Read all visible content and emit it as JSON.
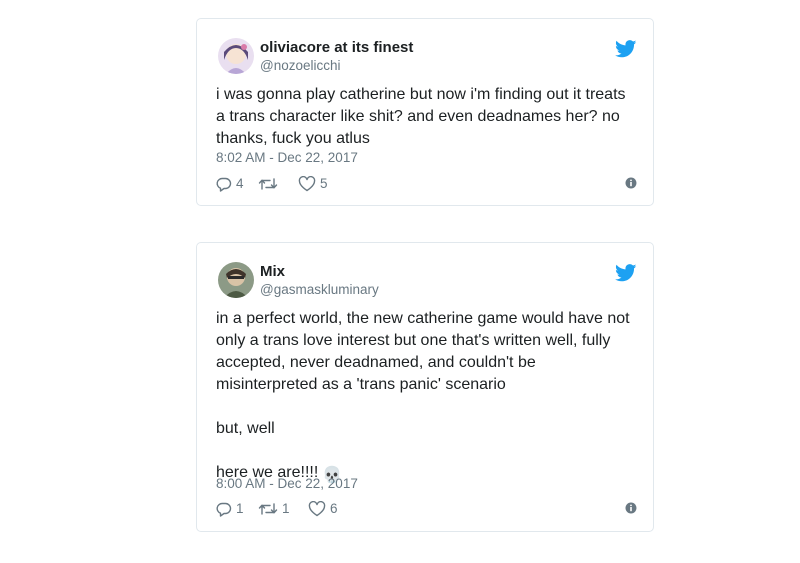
{
  "tweets": [
    {
      "display_name": "oliviacore at its finest",
      "handle": "@nozoelicchi",
      "body": [
        "i was gonna play catherine but now i'm finding out it treats a trans character like shit? and even deadnames her? no thanks, fuck you atlus"
      ],
      "timestamp": "8:02 AM - Dec 22, 2017",
      "replies": "4",
      "retweets": "",
      "likes": "5"
    },
    {
      "display_name": "Mix",
      "handle": "@gasmaskluminary",
      "body": [
        "in a perfect world, the new catherine game would have not only a trans love interest but one that's written well, fully accepted, never deadnamed, and couldn't be misinterpreted as a 'trans panic' scenario",
        "but, well",
        "here we are!!!!"
      ],
      "emoji": "💀",
      "timestamp": "8:00 AM - Dec 22, 2017",
      "replies": "1",
      "retweets": "1",
      "likes": "6"
    }
  ],
  "icons": {
    "brand": "twitter-bird-icon",
    "reply": "reply-icon",
    "retweet": "retweet-icon",
    "like": "heart-icon",
    "info": "info-icon"
  },
  "colors": {
    "twitter_blue": "#1da1f2",
    "text": "#1c2022",
    "muted": "#697882",
    "border": "#e1e8ed"
  }
}
